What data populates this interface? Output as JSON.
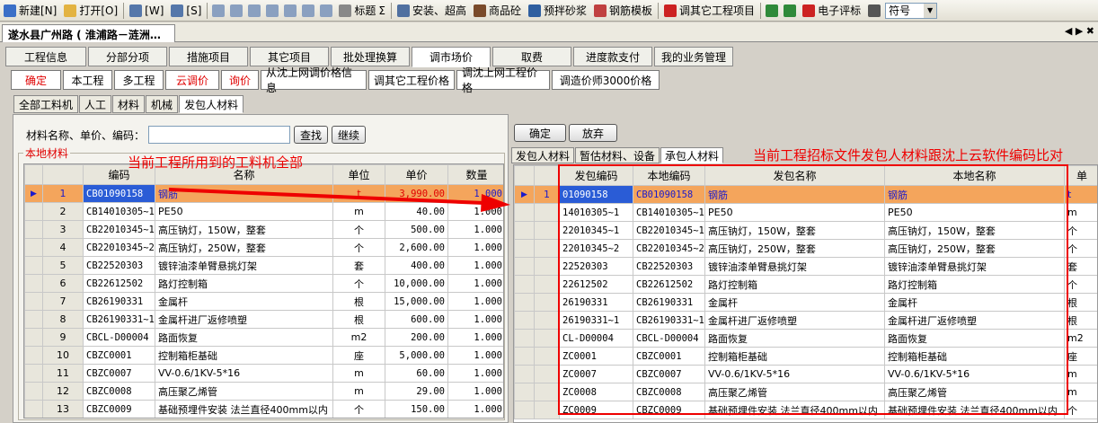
{
  "toolbar": {
    "items": [
      {
        "label": "新建[N]",
        "icon": "new-doc-icon",
        "color": "#3b6fc7"
      },
      {
        "label": "打开[O]",
        "icon": "folder-icon",
        "color": "#e3b341"
      },
      {
        "label": "[W]",
        "icon": "save-icon",
        "color": "#5577aa"
      },
      {
        "label": "[S]",
        "icon": "copy-icon",
        "color": "#5577aa"
      },
      {
        "label": "标题",
        "icon": "title-icon",
        "color": "#888888"
      },
      {
        "label": "安装、超高",
        "icon": "tools-icon",
        "color": "#5070a0"
      },
      {
        "label": "商品砼",
        "icon": "building-icon",
        "color": "#7a4a2a"
      },
      {
        "label": "预拌砂浆",
        "icon": "mixer-icon",
        "color": "#2f5fa0"
      },
      {
        "label": "钢筋模板",
        "icon": "rebar-icon",
        "color": "#c04040"
      },
      {
        "label": "调其它工程项目",
        "icon": "adjust-icon",
        "color": "#cc2222"
      },
      {
        "label": "电子评标",
        "icon": "bid-icon",
        "color": "#cc2222"
      },
      {
        "label": "符号",
        "icon": "symbol-icon",
        "color": "#555555"
      }
    ],
    "sigma": "Σ"
  },
  "document": {
    "tab_title": "遂水县广州路 ( 淮浦路－涟洲…",
    "controls": "◀ ▶ ✖"
  },
  "main_tabs": [
    "工程信息",
    "分部分项",
    "措施项目",
    "其它项目",
    "批处理换算",
    "调市场价",
    "取费",
    "进度款支付",
    "我的业务管理"
  ],
  "main_tabs_active": "调市场价",
  "sub_buttons": [
    {
      "label": "确定",
      "red": true
    },
    {
      "label": "本工程",
      "red": false
    },
    {
      "label": "多工程",
      "red": false
    },
    {
      "label": "云调价",
      "red": true
    },
    {
      "label": "询价",
      "red": true
    },
    {
      "label": "从沈上网调价格信息",
      "red": false
    },
    {
      "label": "调其它工程价格",
      "red": false
    },
    {
      "label": "调沈上网工程价格",
      "red": false
    },
    {
      "label": "调造价师3000价格",
      "red": false
    }
  ],
  "material_tabs": [
    "全部工料机",
    "人工",
    "材料",
    "机械",
    "发包人材料"
  ],
  "material_tabs_active": "发包人材料",
  "left_panel": {
    "search_label": "材料名称、单价、编码：",
    "search_value": "",
    "find_btn": "查找",
    "continue_btn": "继续",
    "group_title": "本地材料",
    "columns": [
      "编码",
      "名称",
      "单位",
      "单价",
      "数量"
    ],
    "rows": [
      {
        "no": "1",
        "code": "CB01090158",
        "name": "钢筋",
        "unit": "t",
        "price": "3,990.00",
        "qty": "1.000"
      },
      {
        "no": "2",
        "code": "CB14010305~1",
        "name": "PE50",
        "unit": "m",
        "price": "40.00",
        "qty": "1.000"
      },
      {
        "no": "3",
        "code": "CB22010345~1",
        "name": "高压钠灯，150W，整套",
        "unit": "个",
        "price": "500.00",
        "qty": "1.000"
      },
      {
        "no": "4",
        "code": "CB22010345~2",
        "name": "高压钠灯，250W，整套",
        "unit": "个",
        "price": "2,600.00",
        "qty": "1.000"
      },
      {
        "no": "5",
        "code": "CB22520303",
        "name": "镀锌油漆单臂悬挑灯架",
        "unit": "套",
        "price": "400.00",
        "qty": "1.000"
      },
      {
        "no": "6",
        "code": "CB22612502",
        "name": "路灯控制箱",
        "unit": "个",
        "price": "10,000.00",
        "qty": "1.000"
      },
      {
        "no": "7",
        "code": "CB26190331",
        "name": "金属杆",
        "unit": "根",
        "price": "15,000.00",
        "qty": "1.000"
      },
      {
        "no": "8",
        "code": "CB26190331~1",
        "name": "金属杆进厂返修喷塑",
        "unit": "根",
        "price": "600.00",
        "qty": "1.000"
      },
      {
        "no": "9",
        "code": "CBCL-D00004",
        "name": "路面恢复",
        "unit": "m2",
        "price": "200.00",
        "qty": "1.000"
      },
      {
        "no": "10",
        "code": "CBZC0001",
        "name": "控制箱柜基础",
        "unit": "座",
        "price": "5,000.00",
        "qty": "1.000"
      },
      {
        "no": "11",
        "code": "CBZC0007",
        "name": "VV-0.6/1KV-5*16",
        "unit": "m",
        "price": "60.00",
        "qty": "1.000"
      },
      {
        "no": "12",
        "code": "CBZC0008",
        "name": "高压聚乙烯管",
        "unit": "m",
        "price": "29.00",
        "qty": "1.000"
      },
      {
        "no": "13",
        "code": "CBZC0009",
        "name": "基础预埋件安装 法兰直径400mm以内",
        "unit": "个",
        "price": "150.00",
        "qty": "1.000"
      }
    ]
  },
  "right_panel": {
    "ok_btn": "确定",
    "cancel_btn": "放弃",
    "tabs": [
      "发包人材料",
      "暂估材料、设备",
      "承包人材料"
    ],
    "tabs_active": "承包人材料",
    "columns": [
      "发包编码",
      "本地编码",
      "发包名称",
      "本地名称",
      "单"
    ],
    "rows": [
      {
        "no": "1",
        "fcode": "01090158",
        "lcode": "CB01090158",
        "fname": "钢筋",
        "lname": "钢筋",
        "unit": "t"
      },
      {
        "no": "",
        "fcode": "14010305~1",
        "lcode": "CB14010305~1",
        "fname": "PE50",
        "lname": "PE50",
        "unit": "m"
      },
      {
        "no": "",
        "fcode": "22010345~1",
        "lcode": "CB22010345~1",
        "fname": "高压钠灯，150W，整套",
        "lname": "高压钠灯，150W，整套",
        "unit": "个"
      },
      {
        "no": "",
        "fcode": "22010345~2",
        "lcode": "CB22010345~2",
        "fname": "高压钠灯，250W，整套",
        "lname": "高压钠灯，250W，整套",
        "unit": "个"
      },
      {
        "no": "",
        "fcode": "22520303",
        "lcode": "CB22520303",
        "fname": "镀锌油漆单臂悬挑灯架",
        "lname": "镀锌油漆单臂悬挑灯架",
        "unit": "套"
      },
      {
        "no": "",
        "fcode": "22612502",
        "lcode": "CB22612502",
        "fname": "路灯控制箱",
        "lname": "路灯控制箱",
        "unit": "个"
      },
      {
        "no": "",
        "fcode": "26190331",
        "lcode": "CB26190331",
        "fname": "金属杆",
        "lname": "金属杆",
        "unit": "根"
      },
      {
        "no": "",
        "fcode": "26190331~1",
        "lcode": "CB26190331~1",
        "fname": "金属杆进厂返修喷塑",
        "lname": "金属杆进厂返修喷塑",
        "unit": "根"
      },
      {
        "no": "",
        "fcode": "CL-D00004",
        "lcode": "CBCL-D00004",
        "fname": "路面恢复",
        "lname": "路面恢复",
        "unit": "m2"
      },
      {
        "no": "",
        "fcode": "ZC0001",
        "lcode": "CBZC0001",
        "fname": "控制箱柜基础",
        "lname": "控制箱柜基础",
        "unit": "座"
      },
      {
        "no": "",
        "fcode": "ZC0007",
        "lcode": "CBZC0007",
        "fname": "VV-0.6/1KV-5*16",
        "lname": "VV-0.6/1KV-5*16",
        "unit": "m"
      },
      {
        "no": "",
        "fcode": "ZC0008",
        "lcode": "CBZC0008",
        "fname": "高压聚乙烯管",
        "lname": "高压聚乙烯管",
        "unit": "m"
      },
      {
        "no": "",
        "fcode": "ZC0009",
        "lcode": "CBZC0009",
        "fname": "基础预埋件安装 法兰直径400mm以内",
        "lname": "基础预埋件安装 法兰直径400mm以内",
        "unit": "个"
      }
    ]
  },
  "annotations": {
    "left": "当前工程所用到的工料机全部",
    "right": "当前工程招标文件发包人材料跟沈上云软件编码比对"
  }
}
